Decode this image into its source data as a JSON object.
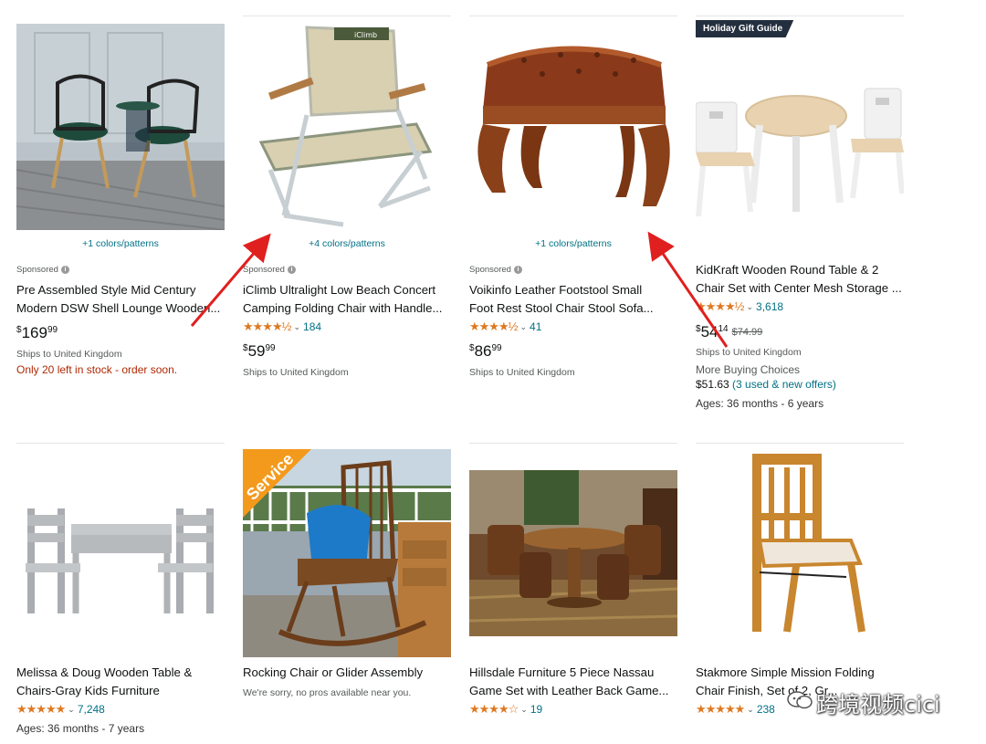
{
  "products": [
    {
      "colors": "+1 colors/patterns",
      "sponsored": "Sponsored",
      "title": "Pre Assembled Style Mid Century Modern DSW Shell Lounge Wooden Chair",
      "title_line1": "Pre Assembled Style Mid Century",
      "title_line2": "Modern DSW Shell Lounge Wooden...",
      "price_symbol": "$",
      "price_whole": "169",
      "price_fraction": "99",
      "shipping": "Ships to United Kingdom",
      "stock": "Only 20 left in stock - order soon."
    },
    {
      "colors": "+4 colors/patterns",
      "sponsored": "Sponsored",
      "title_line1": "iClimb Ultralight Low Beach Concert",
      "title_line2": "Camping Folding Chair with Handle...",
      "brand_print": "iClimb",
      "stars": "★★★★½",
      "rating_count": "184",
      "price_symbol": "$",
      "price_whole": "59",
      "price_fraction": "99",
      "shipping": "Ships to United Kingdom"
    },
    {
      "colors": "+1 colors/patterns",
      "sponsored": "Sponsored",
      "title_line1": "Voikinfo Leather Footstool Small",
      "title_line2": "Foot Rest Stool Chair Stool Sofa...",
      "stars": "★★★★½",
      "rating_count": "41",
      "price_symbol": "$",
      "price_whole": "86",
      "price_fraction": "99",
      "shipping": "Ships to United Kingdom"
    },
    {
      "badge": "Holiday Gift Guide",
      "title_line1": "KidKraft Wooden Round Table & 2",
      "title_line2": "Chair Set with Center Mesh Storage ...",
      "stars": "★★★★½",
      "rating_count": "3,618",
      "price_symbol": "$",
      "price_whole": "54",
      "price_fraction": "14",
      "price_old": "$74.99",
      "shipping": "Ships to United Kingdom",
      "more_buying": "More Buying Choices",
      "offer_price": "$51.63",
      "offer_link": "(3 used & new offers)",
      "ages": "Ages: 36 months - 6 years"
    },
    {
      "title_line1": "Melissa & Doug Wooden Table &",
      "title_line2": "Chairs-Gray Kids Furniture",
      "stars": "★★★★★",
      "rating_count": "7,248",
      "ages": "Ages: 36 months - 7 years"
    },
    {
      "service_ribbon": "Service",
      "title_line1": "Rocking Chair or Glider Assembly",
      "note": "We're sorry, no pros available near you."
    },
    {
      "title_line1": "Hillsdale Furniture 5 Piece Nassau",
      "title_line2": "Game Set with Leather Back Game...",
      "stars": "★★★★☆",
      "rating_count": "19"
    },
    {
      "title_line1": "Stakmore Simple Mission Folding",
      "title_line2": "Chair Finish, Set of 2, Gr...",
      "stars": "★★★★★",
      "rating_count": "238"
    }
  ],
  "watermark": "跨境视频cici",
  "watermark_icon": "wechat-icon",
  "colors": {
    "link": "#007185",
    "star": "#de7921",
    "price_red": "#b12704",
    "arrow": "#e0201f"
  }
}
